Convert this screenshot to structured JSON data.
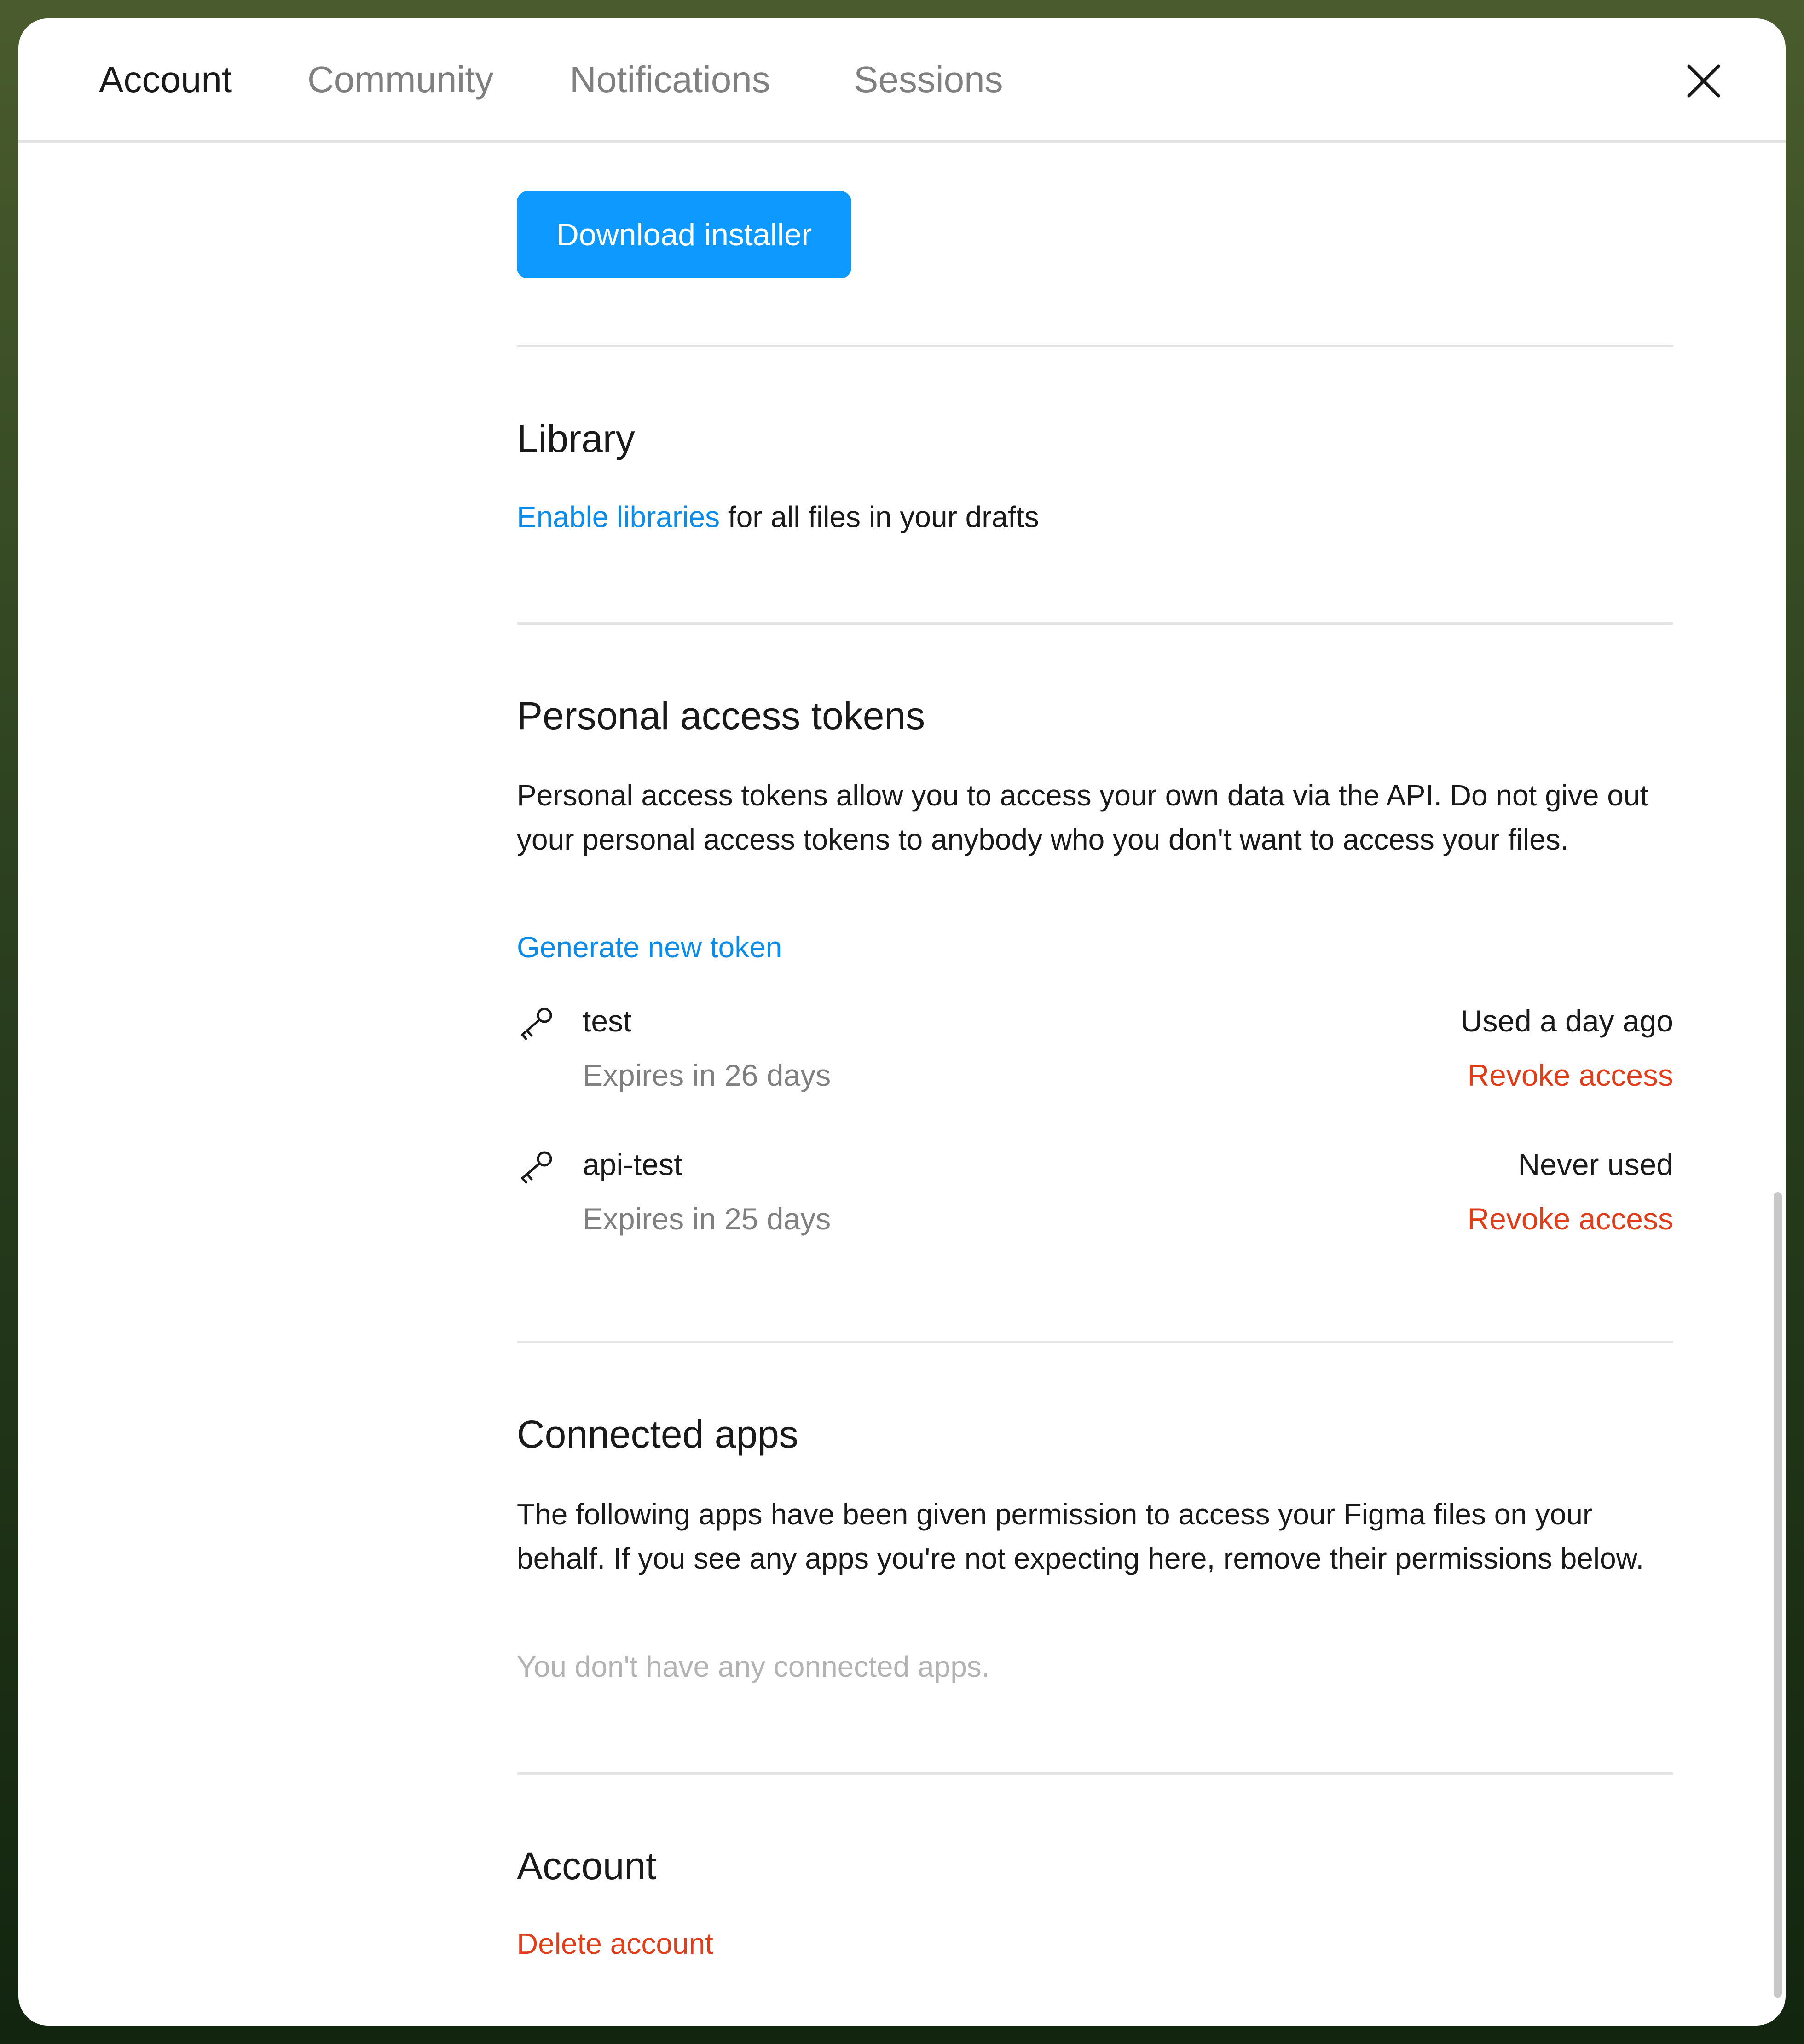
{
  "tabs": [
    {
      "label": "Account"
    },
    {
      "label": "Community"
    },
    {
      "label": "Notifications"
    },
    {
      "label": "Sessions"
    }
  ],
  "download": {
    "label": "Download installer"
  },
  "library": {
    "title": "Library",
    "link": "Enable libraries",
    "text": " for all files in your drafts"
  },
  "tokens": {
    "title": "Personal access tokens",
    "description": "Personal access tokens allow you to access your own data via the API. Do not give out your personal access tokens to anybody who you don't want to access your files.",
    "generate": "Generate new token",
    "items": [
      {
        "name": "test",
        "expires": "Expires in 26 days",
        "used": "Used a day ago",
        "revoke": "Revoke access"
      },
      {
        "name": "api-test",
        "expires": "Expires in 25 days",
        "used": "Never used",
        "revoke": "Revoke access"
      }
    ]
  },
  "apps": {
    "title": "Connected apps",
    "description": "The following apps have been given permission to access your Figma files on your behalf. If you see any apps you're not expecting here, remove their permissions below.",
    "empty": "You don't have any connected apps."
  },
  "account": {
    "title": "Account",
    "delete": "Delete account"
  },
  "colors": {
    "primary": "#0d99ff",
    "link": "#0c8ce9",
    "danger": "#e03e1a"
  }
}
